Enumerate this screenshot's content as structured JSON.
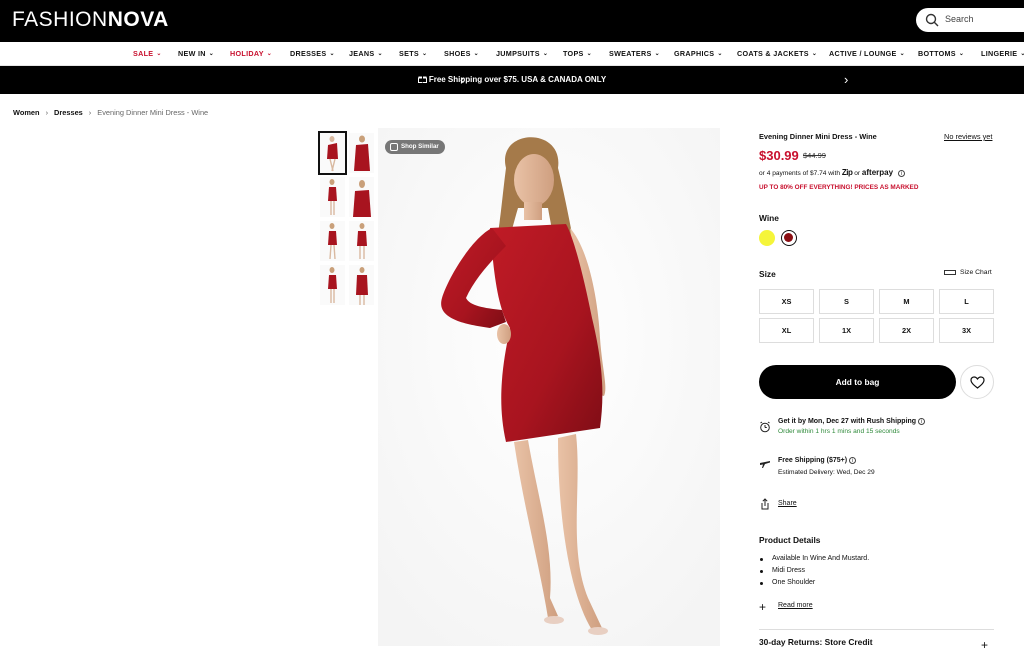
{
  "header": {
    "logo_part1": "FASHION",
    "logo_part2": "NOVA",
    "search_placeholder": "Search"
  },
  "nav": {
    "items": [
      {
        "label": "SALE"
      },
      {
        "label": "NEW IN"
      },
      {
        "label": "HOLIDAY"
      },
      {
        "label": "DRESSES"
      },
      {
        "label": "JEANS"
      },
      {
        "label": "SETS"
      },
      {
        "label": "SHOES"
      },
      {
        "label": "JUMPSUITS"
      },
      {
        "label": "TOPS"
      },
      {
        "label": "SWEATERS"
      },
      {
        "label": "GRAPHICS"
      },
      {
        "label": "COATS & JACKETS"
      },
      {
        "label": "ACTIVE / LOUNGE"
      },
      {
        "label": "BOTTOMS"
      },
      {
        "label": "LINGERIE"
      }
    ],
    "chevron": "⌄"
  },
  "promo": {
    "text": "Free Shipping over $75. USA & CANADA ONLY",
    "prev": "‹",
    "next": "›"
  },
  "breadcrumb": {
    "items": [
      "Women",
      "Dresses",
      "Evening Dinner Mini Dress - Wine"
    ],
    "separator": "›"
  },
  "gallery": {
    "shop_similar": "Shop Similar",
    "dress_color": "#a8141f"
  },
  "product": {
    "title": "Evening Dinner Mini Dress - Wine",
    "reviews": "No reviews yet",
    "price": "$30.99",
    "old_price": "$44.99",
    "payments_prefix": "or 4 payments of $7.74 with",
    "zip_brand": "Zip",
    "or": "or",
    "afterpay_brand": "afterpay",
    "sale_note": "UP TO 80% OFF EVERYTHING! PRICES AS MARKED",
    "color_label": "Wine",
    "swatches": [
      {
        "name": "Mustard",
        "color": "#f5f53a"
      },
      {
        "name": "Wine",
        "color": "#8b0f14"
      }
    ],
    "size_label": "Size",
    "size_chart": "Size Chart",
    "sizes": [
      "XS",
      "S",
      "M",
      "L",
      "XL",
      "1X",
      "2X",
      "3X"
    ],
    "add_to_bag": "Add to bag",
    "rush_title": "Get it by Mon, Dec 27 with Rush Shipping",
    "rush_sub": "Order within 1 hrs 1 mins and 15 seconds",
    "free_title": "Free Shipping ($75+)",
    "free_sub": "Estimated Delivery: Wed, Dec 29",
    "share": "Share",
    "details_title": "Product Details",
    "details": [
      "Available In Wine And Mustard.",
      "Midi Dress",
      "One Shoulder"
    ],
    "read_more": "Read more",
    "returns": "30-day Returns: Store Credit"
  }
}
